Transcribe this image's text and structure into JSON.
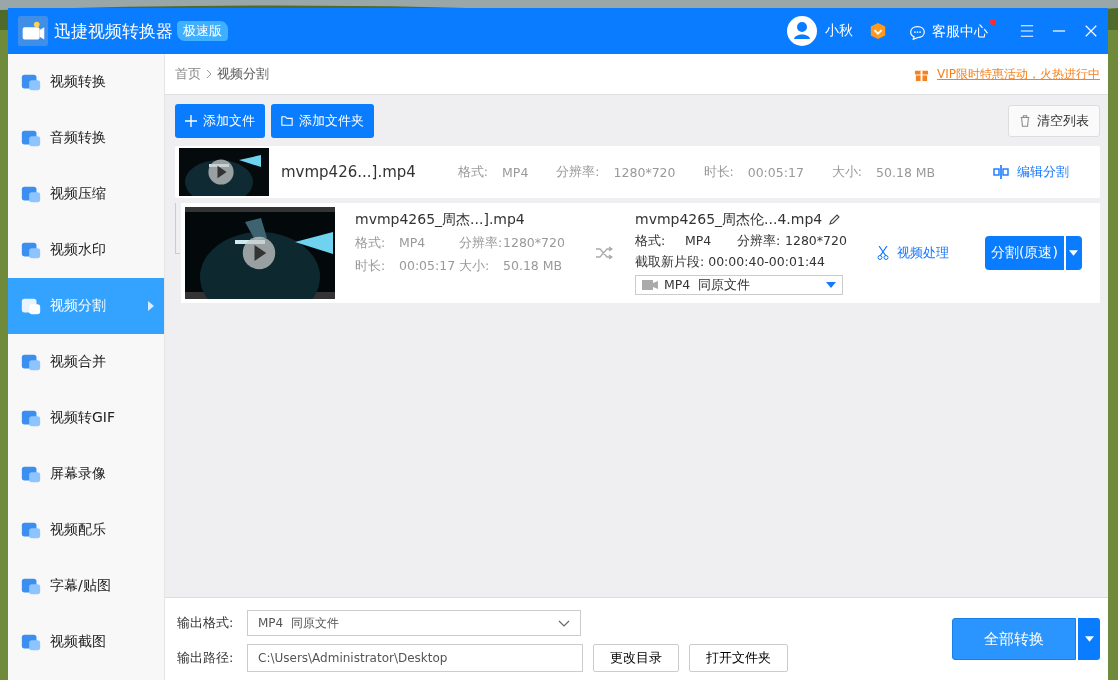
{
  "app": {
    "title": "迅捷视频转换器",
    "edition": "极速版"
  },
  "header": {
    "user_name": "小秋",
    "service_label": "客服中心",
    "service_notification": true
  },
  "breadcrumb": [
    "首页",
    "视频分割"
  ],
  "promo": "VIP限时特惠活动，火热进行中",
  "sidebar": {
    "items": [
      {
        "label": "视频转换",
        "selected": false
      },
      {
        "label": "音频转换",
        "selected": false
      },
      {
        "label": "视频压缩",
        "selected": false
      },
      {
        "label": "视频水印",
        "selected": false
      },
      {
        "label": "视频分割",
        "selected": true
      },
      {
        "label": "视频合并",
        "selected": false
      },
      {
        "label": "视频转GIF",
        "selected": false
      },
      {
        "label": "屏幕录像",
        "selected": false
      },
      {
        "label": "视频配乐",
        "selected": false
      },
      {
        "label": "字幕/贴图",
        "selected": false
      },
      {
        "label": "视频截图",
        "selected": false
      }
    ]
  },
  "toolbar": {
    "add_file": "添加文件",
    "add_folder": "添加文件夹",
    "clear": "清空列表"
  },
  "file": {
    "name": "mvmp426...].mp4",
    "format_label": "格式:",
    "format": "MP4",
    "resolution_label": "分辨率:",
    "resolution": "1280*720",
    "duration_label": "时长:",
    "duration": "00:05:17",
    "size_label": "大小:",
    "size": "50.18 MB",
    "action": "编辑分割"
  },
  "segment": {
    "source_name": "mvmp4265_周杰...].mp4",
    "format_label": "格式:",
    "format": "MP4",
    "resolution_label": "分辨率:",
    "resolution": "1280*720",
    "duration_label": "时长:",
    "duration": "00:05:17",
    "size_label": "大小:",
    "size": "50.18 MB",
    "output_name": "mvmp4265_周杰伦...4.mp4",
    "out_format_label": "格式:",
    "out_format": "MP4",
    "out_resolution_label": "分辨率:",
    "out_resolution": "1280*720",
    "clip_label": "截取新片段:",
    "clip": "00:00:40-00:01:44",
    "output_format": "MP4  同原文件",
    "process": "视频处理",
    "split_button": "分割(原速)"
  },
  "bottom": {
    "format_label": "输出格式:",
    "format": "MP4  同原文件",
    "path_label": "输出路径:",
    "path": "C:\\Users\\Administrator\\Desktop",
    "change_dir": "更改目录",
    "open_folder": "打开文件夹",
    "convert_all": "全部转换"
  }
}
